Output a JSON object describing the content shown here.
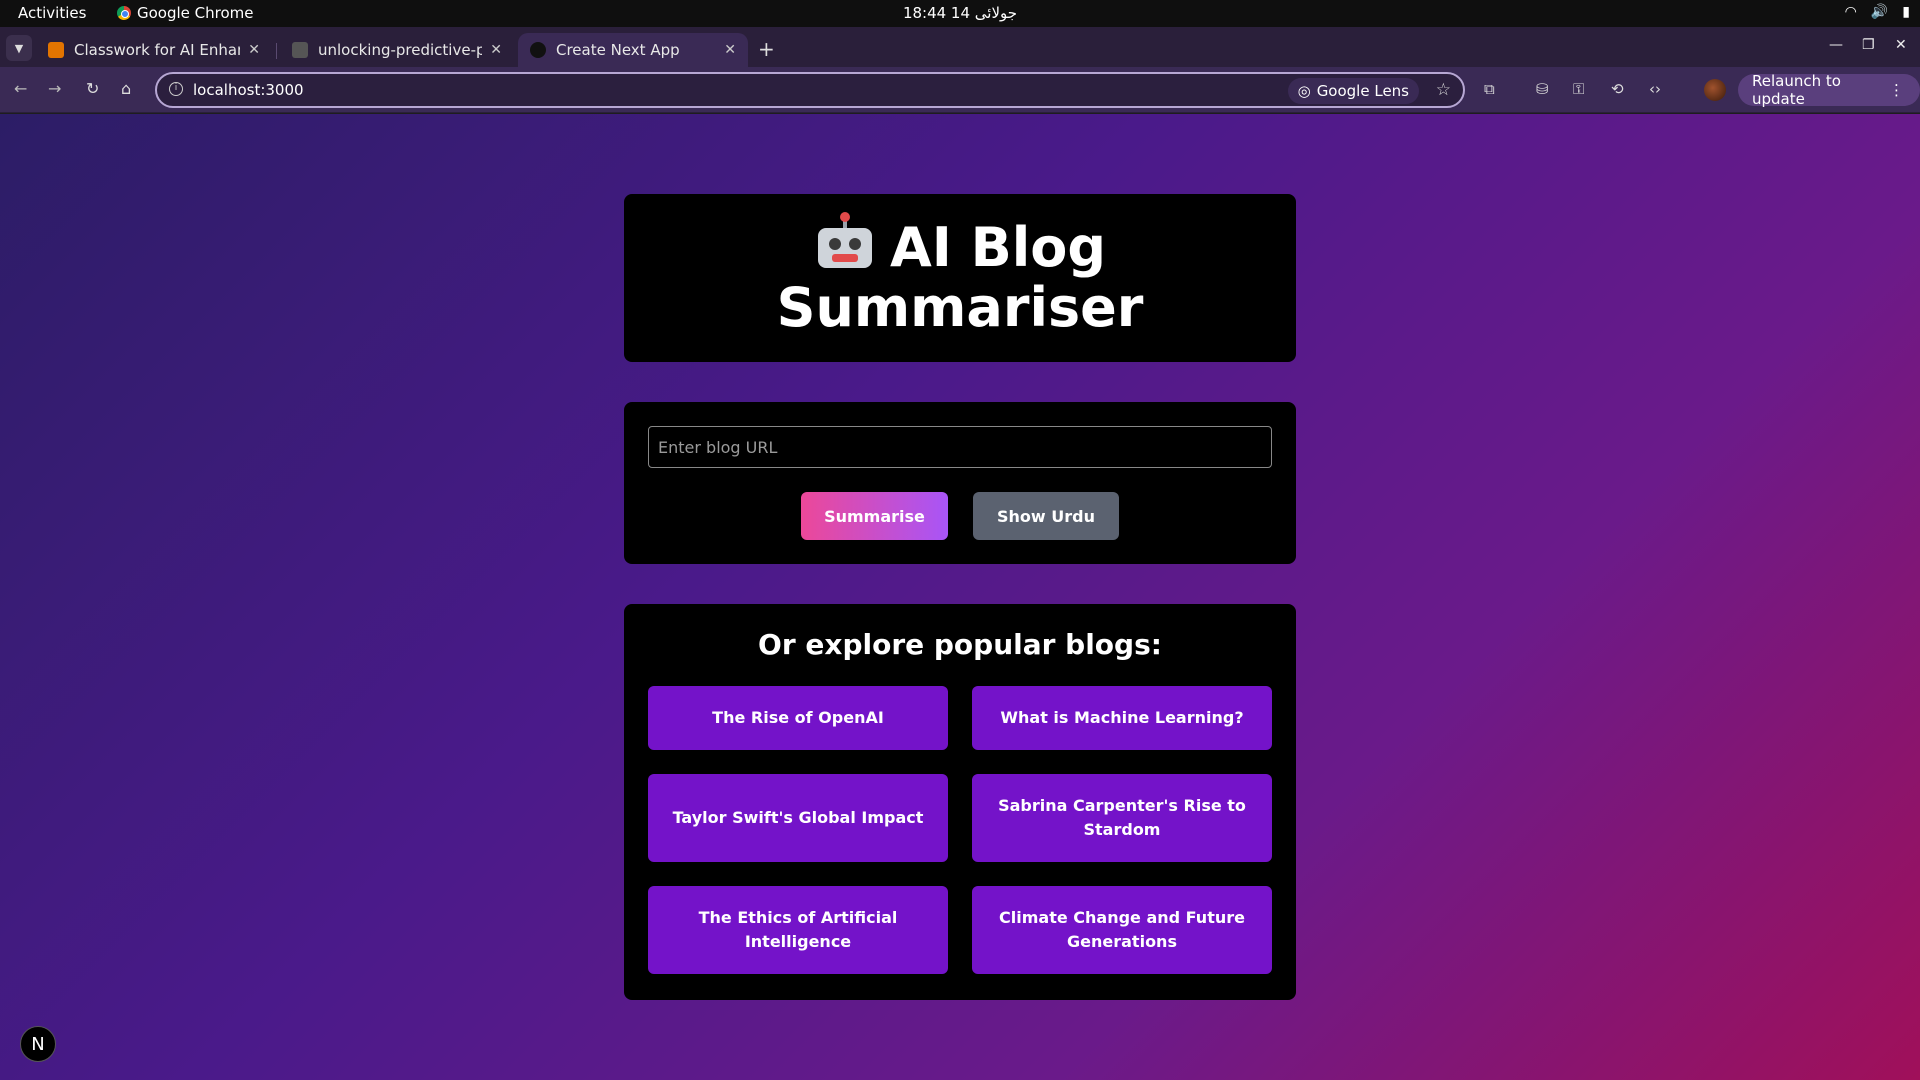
{
  "system_bar": {
    "activities": "Activities",
    "app_name": "Google Chrome",
    "clock": "18:44 14 جولائی"
  },
  "tabs": [
    {
      "title": "Classwork for AI Enhanc",
      "favicon_color": "#e37400"
    },
    {
      "title": "unlocking-predictive-po",
      "favicon_color": "#555555"
    },
    {
      "title": "Create Next App",
      "favicon_color": "#111111",
      "active": true
    }
  ],
  "toolbar": {
    "url": "localhost:3000",
    "google_lens": "Google Lens",
    "relaunch": "Relaunch to update"
  },
  "page": {
    "title": "AI Blog Summariser",
    "url_placeholder": "Enter blog URL",
    "summarise_button": "Summarise",
    "urdu_button": "Show Urdu",
    "explore_heading": "Or explore popular blogs:",
    "blogs": [
      "The Rise of OpenAI",
      "What is Machine Learning?",
      "Taylor Swift's Global Impact",
      "Sabrina Carpenter's Rise to Stardom",
      "The Ethics of Artificial Intelligence",
      "Climate Change and Future Generations"
    ],
    "next_badge": "N"
  },
  "colors": {
    "accent_purple": "#7413c9",
    "summarise_gradient_start": "#ec4899",
    "summarise_gradient_end": "#a855f7",
    "urdu_button": "#5b6270"
  }
}
